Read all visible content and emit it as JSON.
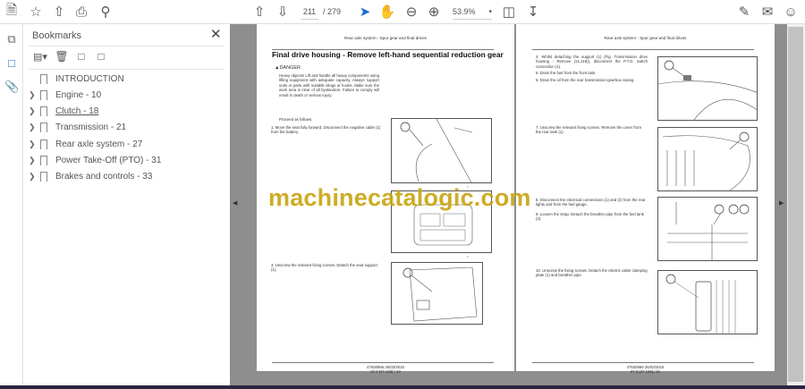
{
  "toolbar": {
    "page_current": "211",
    "page_total": "/ 279",
    "zoom": "53.9%",
    "icons": [
      "save-icon",
      "star-icon",
      "upload-icon",
      "print-icon",
      "search-icon",
      "prev-page-icon",
      "next-page-icon",
      "select-cursor-icon",
      "hand-icon",
      "zoom-out-icon",
      "zoom-in-icon",
      "page-fit-icon",
      "scroll-mode-icon",
      "sign-icon",
      "mail-icon",
      "account-icon"
    ]
  },
  "sidebar": {
    "title": "Bookmarks",
    "items": [
      {
        "label": "INTRODUCTION",
        "expandable": false
      },
      {
        "label": "Engine - 10",
        "expandable": true
      },
      {
        "label": "Clutch - 18",
        "expandable": true,
        "underlined": true
      },
      {
        "label": "Transmission - 21",
        "expandable": true
      },
      {
        "label": "Rear axle system - 27",
        "expandable": true
      },
      {
        "label": "Power Take-Off (PTO) - 31",
        "expandable": true
      },
      {
        "label": "Brakes and controls - 33",
        "expandable": true
      }
    ]
  },
  "left_page": {
    "header": "Rear axle system - Spur gear and final drives",
    "title": "Final drive housing - Remove left-hand sequential reduction gear",
    "danger_label": "DANGER",
    "danger_text": "Heavy objects! Lift and handle all heavy components using lifting equipment with adequate capacity. Always support units or parts with suitable slings or hooks. Make sure the work area is clear of all bystanders. Failure to comply will result in death or serious injury.",
    "intro": "Proceed as follows:",
    "steps": [
      "1.  Move the seat fully forward.  Disconnect the negative cable (1) from the battery.",
      "3.  Unscrew the relevant fixing screws.  Detach the seat support (1)."
    ],
    "footer_doc": "47630966 26/03/2015",
    "footer_page": "27.3 [27.126] / 10"
  },
  "right_page": {
    "header": "Rear axle system - Spur gear and final drives",
    "steps": [
      "4.  Whilst detaching the support (1) (Fig.  Transmission drive housing - Remove (21.118)), disconnect the P.T.O. switch connection (1).",
      "5.  Drain the fuel from the front tank.",
      "6.  Drain the oil from the rear transmission-gearbox casing.",
      "7.  Unscrew the relevant fixing screws. Remove the cover from the rear tank (1).",
      "8.  Disconnect the electrical connections (1) and (2) from the rear lights and from the fuel gauge.",
      "9.  Loosen the strap.  Detach the breather pipe from the fuel tank (3).",
      "10.  Unscrew the fixing screws.  Detach the electric cable clamping plate (1) and breather pipe."
    ],
    "footer_doc": "47630966 26/03/2015",
    "footer_page": "27.3 [27.126] / 11"
  },
  "watermark": "machinecatalogic.com",
  "colors": {
    "accent": "#1a6fc9",
    "watermark": "#c9a514",
    "viewer_bg": "#8e8e8e"
  }
}
